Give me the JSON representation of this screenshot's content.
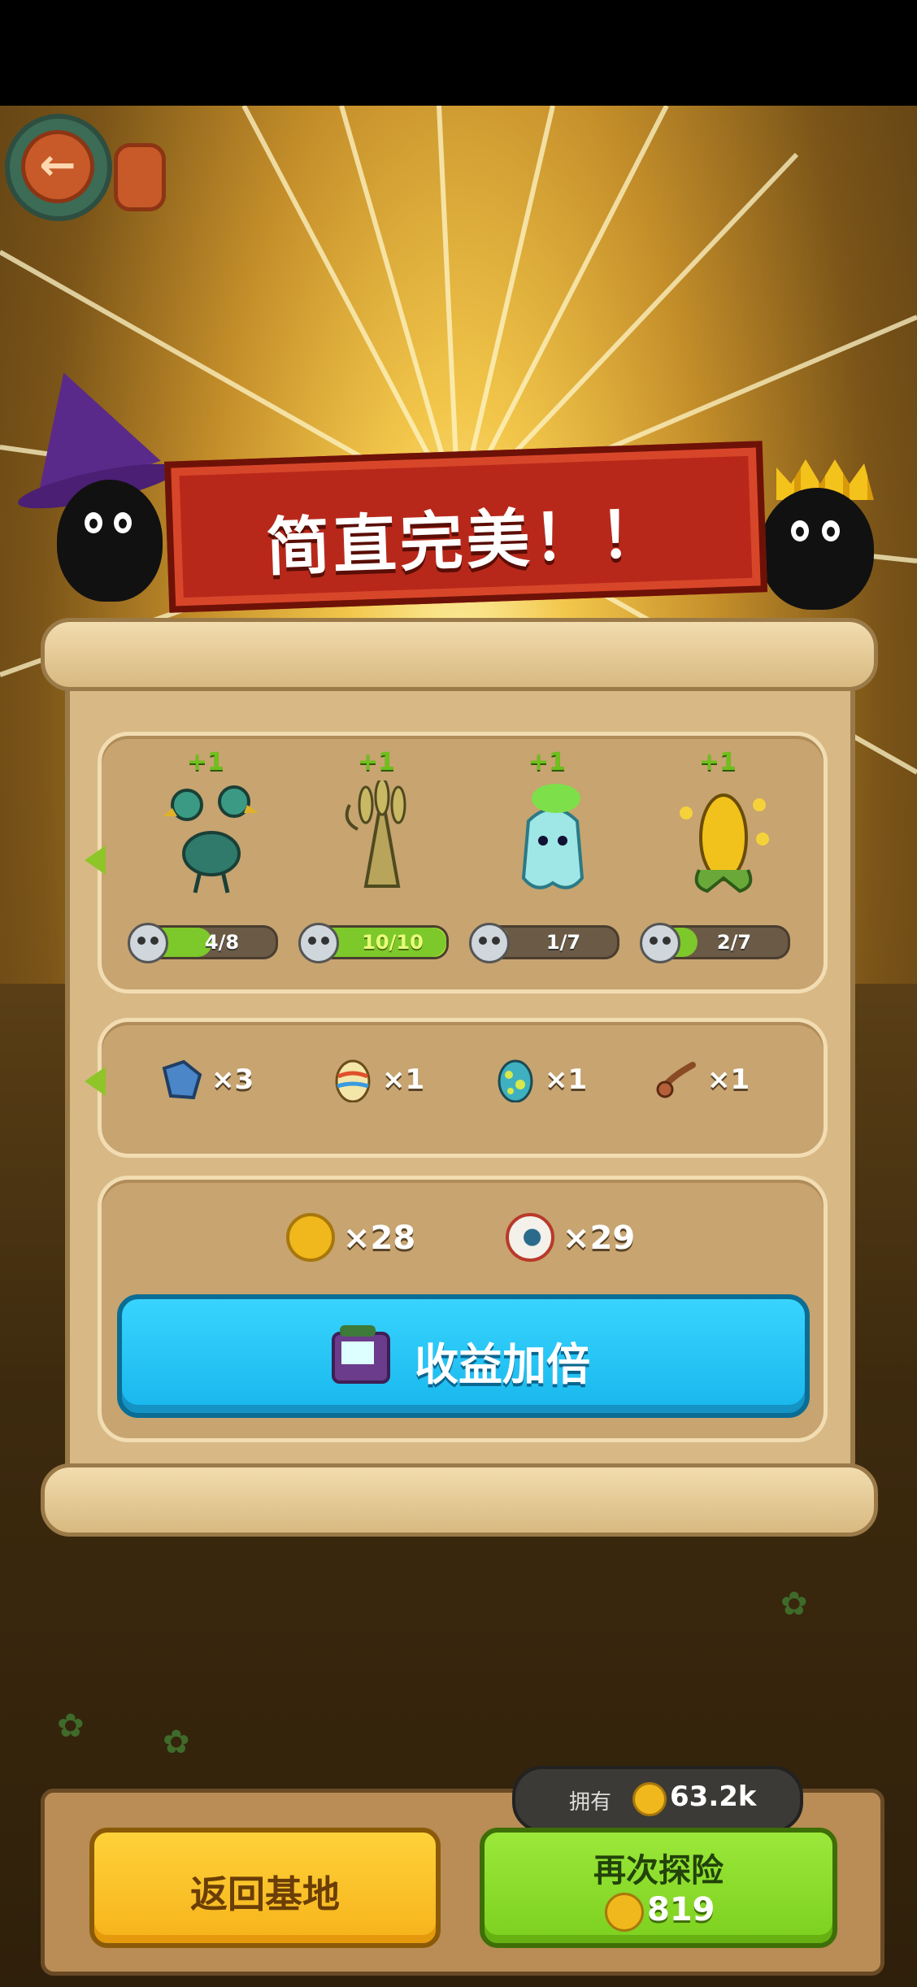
{
  "header": {
    "back_icon": "back-arrow-icon"
  },
  "banner": {
    "title": "简直完美！！"
  },
  "monsters": [
    {
      "plus": "+1",
      "progress_text": "4/8",
      "progress": 0.5,
      "icon": "two-headed-bird-icon"
    },
    {
      "plus": "+1",
      "progress_text": "10/10",
      "progress": 1.0,
      "icon": "wheat-bundle-icon"
    },
    {
      "plus": "+1",
      "progress_text": "1/7",
      "progress": 0.14,
      "icon": "ghost-radish-icon"
    },
    {
      "plus": "+1",
      "progress_text": "2/7",
      "progress": 0.29,
      "icon": "corn-bees-icon"
    }
  ],
  "items": [
    {
      "qty": "×3",
      "icon": "puzzle-piece-icon"
    },
    {
      "qty": "×1",
      "icon": "striped-egg-icon"
    },
    {
      "qty": "×1",
      "icon": "spotted-egg-icon"
    },
    {
      "qty": "×1",
      "icon": "slingshot-icon"
    }
  ],
  "rewards": [
    {
      "qty": "×28",
      "icon": "coin-icon"
    },
    {
      "qty": "×29",
      "icon": "eyeball-icon"
    }
  ],
  "double_button": {
    "label": "收益加倍",
    "icon": "tv-ad-icon"
  },
  "wallet": {
    "label": "拥有",
    "amount": "63.2k"
  },
  "buttons": {
    "home": "返回基地",
    "again": "再次探险",
    "again_cost": "819"
  },
  "colors": {
    "accent_blue": "#18b7ec",
    "accent_green": "#7cd01e",
    "accent_yellow": "#f6b21a",
    "banner_red": "#b8281a"
  }
}
